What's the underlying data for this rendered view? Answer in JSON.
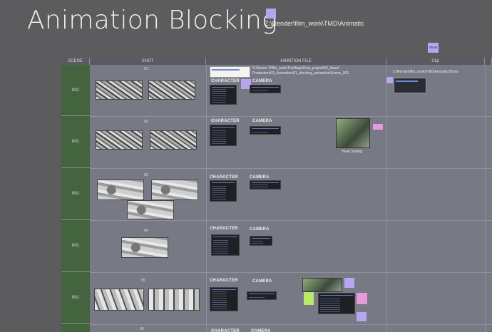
{
  "title": "Animation Blocking",
  "render_path": "Z:\\Render\\film_work\\TMD\\Animatic",
  "shots_note": "Shots",
  "columns": {
    "scene": "SCENE",
    "shot": "SHOT",
    "file": "ANIMTION FILE",
    "clip": "Clip"
  },
  "file_path": "S:\\Server 2\\film_work\\TheMagicDust_project\\02_Asset Production\\03_Animation\\01_blocking_animation\\Scene_001",
  "clip_path": "Z:\\Render\\film_work\\TMD\\Animatic\\Shots",
  "labels": {
    "character": "CHARACTER",
    "camera": "CAMERA",
    "head_setting": "Head Setting"
  },
  "rows": [
    {
      "scene": "001",
      "shot": "01"
    },
    {
      "scene": "001",
      "shot": "02"
    },
    {
      "scene": "001",
      "shot": "03"
    },
    {
      "scene": "001",
      "shot": "04"
    },
    {
      "scene": "001",
      "shot": "05"
    },
    {
      "scene": "",
      "shot": "06"
    }
  ],
  "colors": {
    "scene_cell": "#44633f",
    "board": "#777985",
    "background": "#5c5c5f",
    "note_purple": "#b6a6f0",
    "note_pink": "#e59bd8",
    "note_green": "#b9e86b"
  }
}
